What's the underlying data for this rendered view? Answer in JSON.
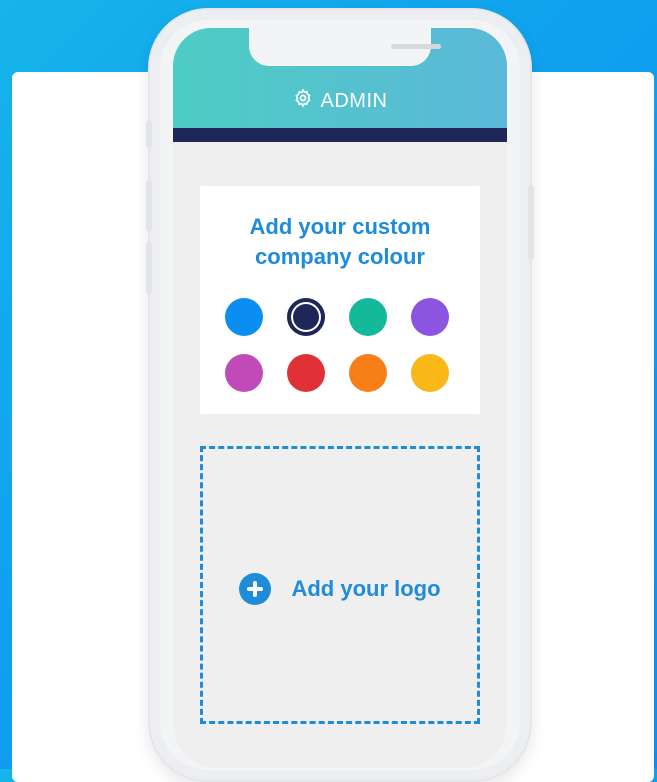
{
  "header": {
    "title": "ADMIN",
    "icon": "gear-icon"
  },
  "color_card": {
    "title_line1": "Add your custom",
    "title_line2": "company colour",
    "swatches": [
      {
        "name": "blue",
        "color": "#0a8ff0",
        "selected": false
      },
      {
        "name": "navy",
        "color": "#1e2757",
        "selected": true
      },
      {
        "name": "teal",
        "color": "#14b89a",
        "selected": false
      },
      {
        "name": "purple",
        "color": "#8b55e0",
        "selected": false
      },
      {
        "name": "magenta",
        "color": "#c04ab8",
        "selected": false
      },
      {
        "name": "red",
        "color": "#e03236",
        "selected": false
      },
      {
        "name": "orange",
        "color": "#f87e17",
        "selected": false
      },
      {
        "name": "yellow",
        "color": "#fab818",
        "selected": false
      }
    ]
  },
  "logo_upload": {
    "label": "Add your logo",
    "icon": "plus-circle-icon"
  },
  "colors": {
    "accent": "#1e8cd9",
    "nav_bar": "#1e2757",
    "header_start": "#4ecdc4",
    "header_end": "#5ab8d8"
  }
}
